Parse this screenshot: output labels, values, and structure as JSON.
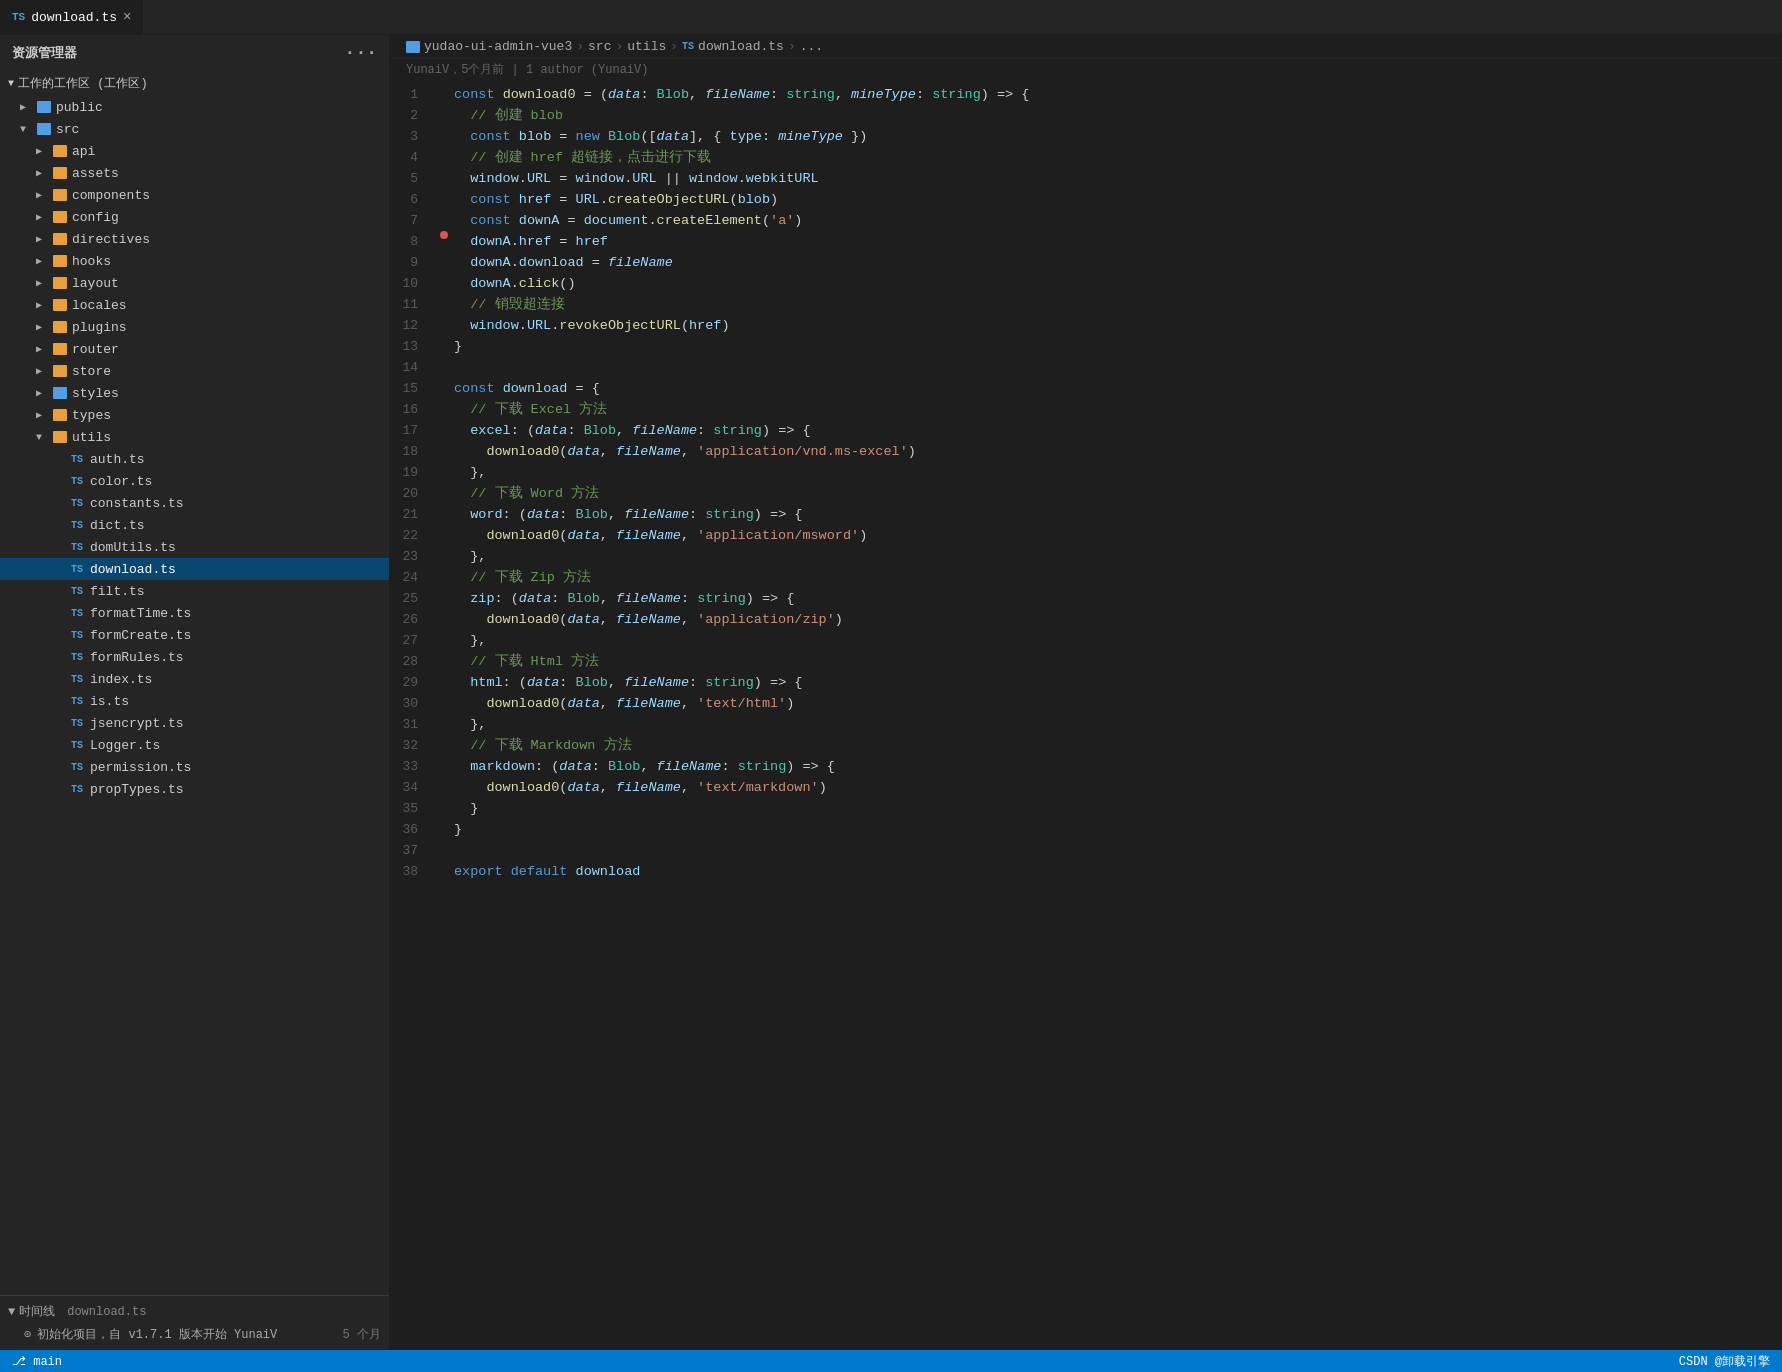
{
  "sidebar": {
    "title": "资源管理器",
    "workspace_label": "工作的工作区 (工作区)",
    "items": [
      {
        "id": "public",
        "label": "public",
        "indent": 1,
        "type": "folder",
        "icon": "folder-blue",
        "chevron": "▶"
      },
      {
        "id": "src",
        "label": "src",
        "indent": 1,
        "type": "folder",
        "icon": "folder-blue",
        "chevron": "▼"
      },
      {
        "id": "api",
        "label": "api",
        "indent": 2,
        "type": "folder",
        "icon": "folder-orange",
        "chevron": "▶"
      },
      {
        "id": "assets",
        "label": "assets",
        "indent": 2,
        "type": "folder",
        "icon": "folder-orange",
        "chevron": "▶"
      },
      {
        "id": "components",
        "label": "components",
        "indent": 2,
        "type": "folder",
        "icon": "folder-orange",
        "chevron": "▶"
      },
      {
        "id": "config",
        "label": "config",
        "indent": 2,
        "type": "folder",
        "icon": "folder-orange",
        "chevron": "▶"
      },
      {
        "id": "directives",
        "label": "directives",
        "indent": 2,
        "type": "folder",
        "icon": "folder-orange",
        "chevron": "▶"
      },
      {
        "id": "hooks",
        "label": "hooks",
        "indent": 2,
        "type": "folder",
        "icon": "folder-orange",
        "chevron": "▶"
      },
      {
        "id": "layout",
        "label": "layout",
        "indent": 2,
        "type": "folder",
        "icon": "folder-orange",
        "chevron": "▶"
      },
      {
        "id": "locales",
        "label": "locales",
        "indent": 2,
        "type": "folder",
        "icon": "folder-orange",
        "chevron": "▶"
      },
      {
        "id": "plugins",
        "label": "plugins",
        "indent": 2,
        "type": "folder",
        "icon": "folder-orange",
        "chevron": "▶"
      },
      {
        "id": "router",
        "label": "router",
        "indent": 2,
        "type": "folder",
        "icon": "folder-orange",
        "chevron": "▶"
      },
      {
        "id": "store",
        "label": "store",
        "indent": 2,
        "type": "folder",
        "icon": "folder-orange",
        "chevron": "▶"
      },
      {
        "id": "styles",
        "label": "styles",
        "indent": 2,
        "type": "folder",
        "icon": "folder-blue",
        "chevron": "▶"
      },
      {
        "id": "types",
        "label": "types",
        "indent": 2,
        "type": "folder",
        "icon": "folder-orange",
        "chevron": "▶"
      },
      {
        "id": "utils",
        "label": "utils",
        "indent": 2,
        "type": "folder",
        "icon": "folder-orange",
        "chevron": "▼"
      },
      {
        "id": "auth.ts",
        "label": "auth.ts",
        "indent": 3,
        "type": "file",
        "ts": true
      },
      {
        "id": "color.ts",
        "label": "color.ts",
        "indent": 3,
        "type": "file",
        "ts": true
      },
      {
        "id": "constants.ts",
        "label": "constants.ts",
        "indent": 3,
        "type": "file",
        "ts": true
      },
      {
        "id": "dict.ts",
        "label": "dict.ts",
        "indent": 3,
        "type": "file",
        "ts": true
      },
      {
        "id": "domUtils.ts",
        "label": "domUtils.ts",
        "indent": 3,
        "type": "file",
        "ts": true
      },
      {
        "id": "download.ts",
        "label": "download.ts",
        "indent": 3,
        "type": "file",
        "ts": true,
        "active": true
      },
      {
        "id": "filt.ts",
        "label": "filt.ts",
        "indent": 3,
        "type": "file",
        "ts": true
      },
      {
        "id": "formatTime.ts",
        "label": "formatTime.ts",
        "indent": 3,
        "type": "file",
        "ts": true
      },
      {
        "id": "formCreate.ts",
        "label": "formCreate.ts",
        "indent": 3,
        "type": "file",
        "ts": true
      },
      {
        "id": "formRules.ts",
        "label": "formRules.ts",
        "indent": 3,
        "type": "file",
        "ts": true
      },
      {
        "id": "index.ts",
        "label": "index.ts",
        "indent": 3,
        "type": "file",
        "ts": true
      },
      {
        "id": "is.ts",
        "label": "is.ts",
        "indent": 3,
        "type": "file",
        "ts": true
      },
      {
        "id": "jsencrypt.ts",
        "label": "jsencrypt.ts",
        "indent": 3,
        "type": "file",
        "ts": true
      },
      {
        "id": "Logger.ts",
        "label": "Logger.ts",
        "indent": 3,
        "type": "file",
        "ts": true
      },
      {
        "id": "permission.ts",
        "label": "permission.ts",
        "indent": 3,
        "type": "file",
        "ts": true
      },
      {
        "id": "propTypes.ts",
        "label": "propTypes.ts",
        "indent": 3,
        "type": "file",
        "ts": true
      }
    ],
    "timeline": {
      "label": "时间线",
      "items": [
        {
          "label": "download.ts"
        },
        {
          "icon": "⊙",
          "label": "初始化项目，自 v1.7.1 版本开始  YunaiV",
          "time": "5 个月"
        }
      ]
    }
  },
  "tab": {
    "ts_badge": "TS",
    "filename": "download.ts",
    "close": "×"
  },
  "breadcrumb": {
    "parts": [
      "yudao-ui-admin-vue3",
      "src",
      "utils",
      "download.ts",
      "..."
    ],
    "ts_badge": "TS"
  },
  "git_blame": {
    "text": "YunaiV，5个月前 | 1 author (YunaiV)"
  },
  "code": {
    "lines": [
      {
        "num": 1,
        "html": "<span class='kw'>const</span> <span class='fn'>download0</span> <span class='op'>=</span> <span class='op'>(</span><span class='param-italic'>data</span><span class='op'>:</span> <span class='ty'>Blob</span><span class='op'>,</span> <span class='param-italic'>fileName</span><span class='op'>:</span> <span class='ty'>string</span><span class='op'>,</span> <span class='param-italic'>mineType</span><span class='op'>:</span> <span class='ty'>string</span><span class='op'>)</span> <span class='op'>=></span> <span class='op'>{</span>"
      },
      {
        "num": 2,
        "html": "  <span class='cm'>// 创建 blob</span>"
      },
      {
        "num": 3,
        "html": "  <span class='kw'>const</span> <span class='var'>blob</span> <span class='op'>=</span> <span class='kw'>new</span> <span class='ty'>Blob</span><span class='op'>([</span><span class='param-italic'>data</span><span class='op'>],</span> <span class='op'>{</span> <span class='prop'>type</span><span class='op'>:</span> <span class='param-italic'>mineType</span> <span class='op'>})</span>"
      },
      {
        "num": 4,
        "html": "  <span class='cm'>// 创建 href 超链接，点击进行下载</span>"
      },
      {
        "num": 5,
        "html": "  <span class='var'>window</span><span class='op'>.</span><span class='prop'>URL</span> <span class='op'>=</span> <span class='var'>window</span><span class='op'>.</span><span class='prop'>URL</span> <span class='op'>||</span> <span class='var'>window</span><span class='op'>.</span><span class='prop'>webkitURL</span>"
      },
      {
        "num": 6,
        "html": "  <span class='kw'>const</span> <span class='var'>href</span> <span class='op'>=</span> <span class='var'>URL</span><span class='op'>.</span><span class='fn'>createObjectURL</span><span class='op'>(</span><span class='var'>blob</span><span class='op'>)</span>"
      },
      {
        "num": 7,
        "html": "  <span class='kw'>const</span> <span class='var'>downA</span> <span class='op'>=</span> <span class='var'>document</span><span class='op'>.</span><span class='fn'>createElement</span><span class='op'>(</span><span class='str'>'a'</span><span class='op'>)</span>"
      },
      {
        "num": 8,
        "html": "  <span class='var'>downA</span><span class='op'>.</span><span class='prop'>href</span> <span class='op'>=</span> <span class='var'>href</span>",
        "dot": true
      },
      {
        "num": 9,
        "html": "  <span class='var'>downA</span><span class='op'>.</span><span class='prop'>download</span> <span class='op'>=</span> <span class='param-italic'>fileName</span>"
      },
      {
        "num": 10,
        "html": "  <span class='var'>downA</span><span class='op'>.</span><span class='fn'>click</span><span class='op'>()</span>"
      },
      {
        "num": 11,
        "html": "  <span class='cm'>// 销毁超连接</span>"
      },
      {
        "num": 12,
        "html": "  <span class='var'>window</span><span class='op'>.</span><span class='var'>URL</span><span class='op'>.</span><span class='fn'>revokeObjectURL</span><span class='op'>(</span><span class='var'>href</span><span class='op'>)</span>"
      },
      {
        "num": 13,
        "html": "<span class='op'>}</span>"
      },
      {
        "num": 14,
        "html": ""
      },
      {
        "num": 15,
        "html": "<span class='kw'>const</span> <span class='var'>download</span> <span class='op'>=</span> <span class='op'>{</span>"
      },
      {
        "num": 16,
        "html": "  <span class='cm'>// 下载 Excel 方法</span>"
      },
      {
        "num": 17,
        "html": "  <span class='prop'>excel</span><span class='op'>:</span> <span class='op'>(</span><span class='param-italic'>data</span><span class='op'>:</span> <span class='ty'>Blob</span><span class='op'>,</span> <span class='param-italic'>fileName</span><span class='op'>:</span> <span class='ty'>string</span><span class='op'>)</span> <span class='op'>=></span> <span class='op'>{</span>"
      },
      {
        "num": 18,
        "html": "    <span class='fn'>download0</span><span class='op'>(</span><span class='param-italic'>data</span><span class='op'>,</span> <span class='param-italic'>fileName</span><span class='op'>,</span> <span class='str'>'application/vnd.ms-excel'</span><span class='op'>)</span>"
      },
      {
        "num": 19,
        "html": "  <span class='op'>},</span>"
      },
      {
        "num": 20,
        "html": "  <span class='cm'>// 下载 Word 方法</span>"
      },
      {
        "num": 21,
        "html": "  <span class='prop'>word</span><span class='op'>:</span> <span class='op'>(</span><span class='param-italic'>data</span><span class='op'>:</span> <span class='ty'>Blob</span><span class='op'>,</span> <span class='param-italic'>fileName</span><span class='op'>:</span> <span class='ty'>string</span><span class='op'>)</span> <span class='op'>=></span> <span class='op'>{</span>"
      },
      {
        "num": 22,
        "html": "    <span class='fn'>download0</span><span class='op'>(</span><span class='param-italic'>data</span><span class='op'>,</span> <span class='param-italic'>fileName</span><span class='op'>,</span> <span class='str'>'application/msword'</span><span class='op'>)</span>"
      },
      {
        "num": 23,
        "html": "  <span class='op'>},</span>"
      },
      {
        "num": 24,
        "html": "  <span class='cm'>// 下载 Zip 方法</span>"
      },
      {
        "num": 25,
        "html": "  <span class='prop'>zip</span><span class='op'>:</span> <span class='op'>(</span><span class='param-italic'>data</span><span class='op'>:</span> <span class='ty'>Blob</span><span class='op'>,</span> <span class='param-italic'>fileName</span><span class='op'>:</span> <span class='ty'>string</span><span class='op'>)</span> <span class='op'>=></span> <span class='op'>{</span>"
      },
      {
        "num": 26,
        "html": "    <span class='fn'>download0</span><span class='op'>(</span><span class='param-italic'>data</span><span class='op'>,</span> <span class='param-italic'>fileName</span><span class='op'>,</span> <span class='str'>'application/zip'</span><span class='op'>)</span>"
      },
      {
        "num": 27,
        "html": "  <span class='op'>},</span>"
      },
      {
        "num": 28,
        "html": "  <span class='cm'>// 下载 Html 方法</span>"
      },
      {
        "num": 29,
        "html": "  <span class='prop'>html</span><span class='op'>:</span> <span class='op'>(</span><span class='param-italic'>data</span><span class='op'>:</span> <span class='ty'>Blob</span><span class='op'>,</span> <span class='param-italic'>fileName</span><span class='op'>:</span> <span class='ty'>string</span><span class='op'>)</span> <span class='op'>=></span> <span class='op'>{</span>"
      },
      {
        "num": 30,
        "html": "    <span class='fn'>download0</span><span class='op'>(</span><span class='param-italic'>data</span><span class='op'>,</span> <span class='param-italic'>fileName</span><span class='op'>,</span> <span class='str'>'text/html'</span><span class='op'>)</span>"
      },
      {
        "num": 31,
        "html": "  <span class='op'>},</span>"
      },
      {
        "num": 32,
        "html": "  <span class='cm'>// 下载 Markdown 方法</span>"
      },
      {
        "num": 33,
        "html": "  <span class='prop'>markdown</span><span class='op'>:</span> <span class='op'>(</span><span class='param-italic'>data</span><span class='op'>:</span> <span class='ty'>Blob</span><span class='op'>,</span> <span class='param-italic'>fileName</span><span class='op'>:</span> <span class='ty'>string</span><span class='op'>)</span> <span class='op'>=></span> <span class='op'>{</span>"
      },
      {
        "num": 34,
        "html": "    <span class='fn'>download0</span><span class='op'>(</span><span class='param-italic'>data</span><span class='op'>,</span> <span class='param-italic'>fileName</span><span class='op'>,</span> <span class='str'>'text/markdown'</span><span class='op'>)</span>"
      },
      {
        "num": 35,
        "html": "  <span class='op'>}</span>"
      },
      {
        "num": 36,
        "html": "<span class='op'>}</span>"
      },
      {
        "num": 37,
        "html": ""
      },
      {
        "num": 38,
        "html": "<span class='kw'>export</span> <span class='kw'>default</span> <span class='var'>download</span>"
      }
    ]
  },
  "status_bar": {
    "left": [
      {
        "icon": "⎇",
        "label": "main"
      }
    ],
    "right": [
      {
        "label": "CSDN @卸载引擎"
      }
    ]
  }
}
